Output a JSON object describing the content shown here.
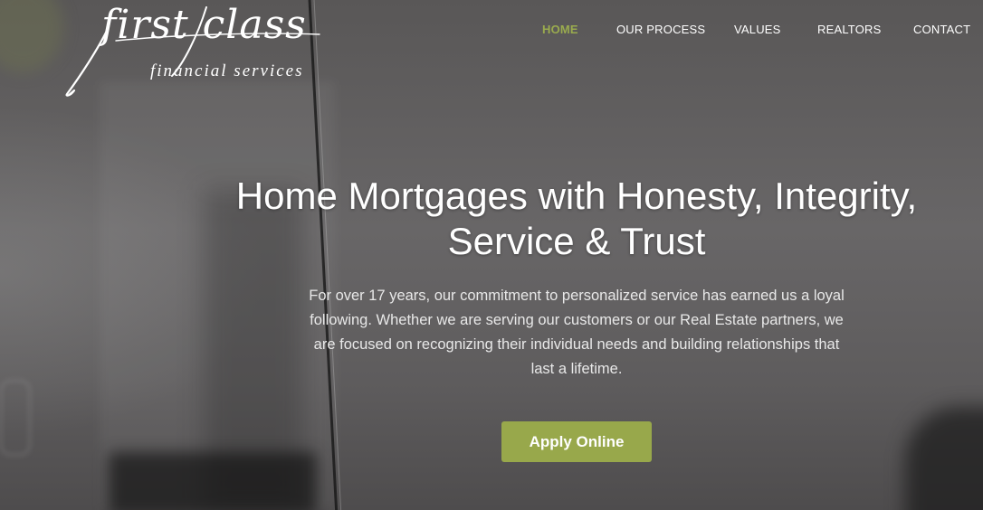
{
  "logo": {
    "main": "first class",
    "sub": "financial services"
  },
  "nav": {
    "items": [
      {
        "label": "HOME",
        "active": true
      },
      {
        "label": "OUR PROCESS",
        "active": false
      },
      {
        "label": "VALUES",
        "active": false
      },
      {
        "label": "REALTORS",
        "active": false
      },
      {
        "label": "CONTACT",
        "active": false
      }
    ]
  },
  "hero": {
    "headline_line1": "Home Mortgages with Honesty, Integrity,",
    "headline_line2": "Service & Trust",
    "intro": "For over 17 years, our commitment to personalized service has earned us a loyal following. Whether we are serving our customers or our Real Estate partners, we are focused on recognizing their individual needs and building relationships that last a lifetime.",
    "cta_label": "Apply Online"
  },
  "colors": {
    "accent": "#98a84b",
    "nav_active": "#9aab4e",
    "text": "#ffffff"
  }
}
